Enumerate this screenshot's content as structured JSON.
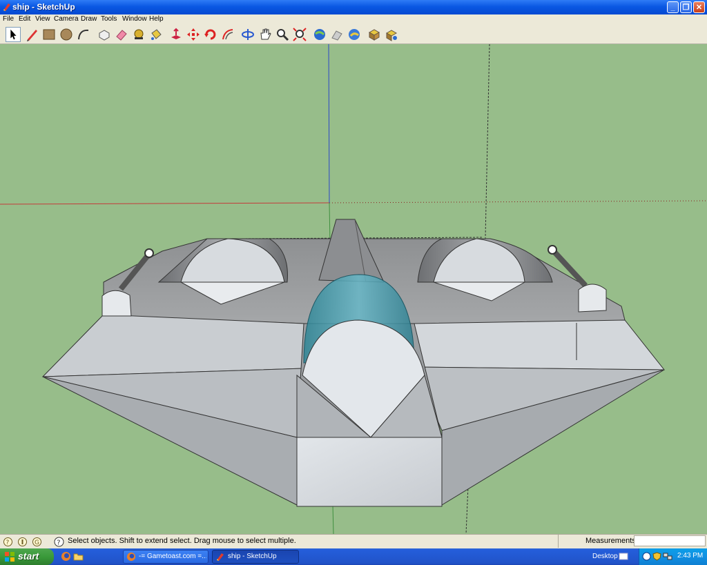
{
  "window": {
    "title": "ship - SketchUp"
  },
  "menu": [
    "File",
    "Edit",
    "View",
    "Camera",
    "Draw",
    "Tools",
    "Window",
    "Help"
  ],
  "toolbar": {
    "tools": [
      "select-icon",
      "pencil-icon",
      "rectangle-icon",
      "circle-icon",
      "arc-icon",
      "make-component-icon",
      "eraser-icon",
      "tape-measure-icon",
      "paint-bucket-icon",
      "push-pull-icon",
      "move-icon",
      "rotate-icon",
      "offset-icon",
      "orbit-icon",
      "pan-icon",
      "zoom-icon",
      "zoom-extents-icon",
      "get-models-icon",
      "share-model-icon",
      "google-earth-icon",
      "component-icon",
      "component-browser-icon"
    ]
  },
  "status": {
    "message": "Select objects. Shift to extend select. Drag mouse to select multiple.",
    "measurements_label": "Measurements",
    "measurements_value": ""
  },
  "taskbar": {
    "start_label": "start",
    "tasks": [
      {
        "label": "-= Gametoast.com =..."
      },
      {
        "label": "ship - SketchUp"
      }
    ],
    "desktop_label": "Desktop",
    "clock": "2:43 PM"
  },
  "colors": {
    "viewport_bg": "#97bd8a",
    "axis_red": "#c43a3a",
    "axis_blue": "#2b47c8",
    "axis_green": "#3f8f3f",
    "glass": "#4ea7b8"
  }
}
